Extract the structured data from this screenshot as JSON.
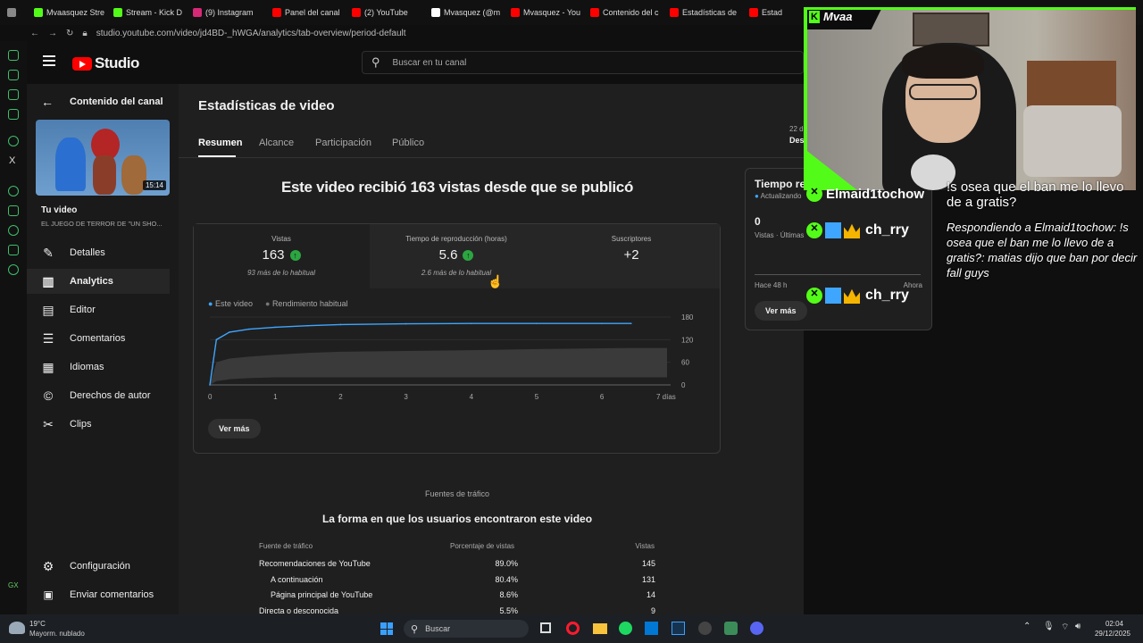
{
  "browser": {
    "tabs": [
      {
        "label": "",
        "color": "#888888"
      },
      {
        "label": "Mvaasquez Stre",
        "color": "#53fc18"
      },
      {
        "label": "Stream - Kick D",
        "color": "#53fc18"
      },
      {
        "label": "(9) Instagram",
        "color": "#d62976"
      },
      {
        "label": "Panel del canal",
        "color": "#ff0000"
      },
      {
        "label": "(2) YouTube",
        "color": "#ff0000"
      },
      {
        "label": "Mvasquez (@m",
        "color": "#ffffff"
      },
      {
        "label": "Mvasquez - You",
        "color": "#ff0000"
      },
      {
        "label": "Contenido del c",
        "color": "#ff0000"
      },
      {
        "label": "Estadísticas de",
        "color": "#ff0000"
      },
      {
        "label": "Estad",
        "color": "#ff0000"
      }
    ],
    "url": "studio.youtube.com/video/jd4BD-_hWGA/analytics/tab-overview/period-default"
  },
  "header": {
    "logo_text": "Studio",
    "search_placeholder": "Buscar en tu canal"
  },
  "sidebar": {
    "back_label": "Contenido del canal",
    "thumb_duration": "15:14",
    "your_video": "Tu video",
    "video_title": "EL JUEGO DE TERROR DE \"UN SHO...",
    "items": [
      {
        "label": "Detalles",
        "icon": "pencil-icon"
      },
      {
        "label": "Analytics",
        "icon": "analytics-icon"
      },
      {
        "label": "Editor",
        "icon": "editor-icon"
      },
      {
        "label": "Comentarios",
        "icon": "comments-icon"
      },
      {
        "label": "Idiomas",
        "icon": "subtitles-icon"
      },
      {
        "label": "Derechos de autor",
        "icon": "copyright-icon"
      },
      {
        "label": "Clips",
        "icon": "scissors-icon"
      }
    ],
    "settings_label": "Configuración",
    "feedback_label": "Enviar comentarios"
  },
  "page": {
    "title": "Estadísticas de video",
    "tabs": [
      "Resumen",
      "Alcance",
      "Participación",
      "Público"
    ],
    "date_partial": "22 d",
    "date_partial2": "Des",
    "headline": "Este video recibió 163 vistas desde que se publicó",
    "metrics": [
      {
        "label": "Vistas",
        "value": "163",
        "note": "93 más de lo habitual",
        "up": true
      },
      {
        "label": "Tiempo de reproducción (horas)",
        "value": "5.6",
        "note": "2.6 más de lo habitual",
        "up": true
      },
      {
        "label": "Suscriptores",
        "value": "+2",
        "note": "",
        "up": false
      }
    ],
    "legend": [
      "Este video",
      "Rendimiento habitual"
    ],
    "see_more": "Ver más",
    "realtime": {
      "title": "Tiempo re",
      "updating": "Actualizando",
      "count": "0",
      "sub": "Vistas · Últimas",
      "left": "Hace 48 h",
      "right": "Ahora",
      "button": "Ver más"
    },
    "traffic": {
      "kicker": "Fuentes de tráfico",
      "title": "La forma en que los usuarios encontraron este video",
      "headers": [
        "Fuente de tráfico",
        "Porcentaje de vistas",
        "Vistas"
      ],
      "rows": [
        {
          "source": "Recomendaciones de YouTube",
          "pct": "89.0%",
          "views": "145",
          "indent": false
        },
        {
          "source": "A continuación",
          "pct": "80.4%",
          "views": "131",
          "indent": true
        },
        {
          "source": "Página principal de YouTube",
          "pct": "8.6%",
          "views": "14",
          "indent": true
        },
        {
          "source": "Directa o desconocida",
          "pct": "5.5%",
          "views": "9",
          "indent": false
        }
      ]
    }
  },
  "chart_data": {
    "type": "line",
    "x": [
      0,
      0.1,
      0.3,
      0.6,
      1,
      1.5,
      2,
      3,
      4,
      5,
      6,
      6.45
    ],
    "xticks": [
      "0",
      "1",
      "2",
      "3",
      "4",
      "5",
      "6",
      "7 días"
    ],
    "yticks": [
      "180",
      "120",
      "60",
      "0"
    ],
    "ylim": [
      0,
      180
    ],
    "xlim": [
      0,
      7
    ],
    "series": [
      {
        "name": "Este video",
        "color": "#3ea6ff",
        "values": [
          0,
          120,
          140,
          148,
          153,
          157,
          160,
          162,
          163,
          163,
          163,
          163
        ]
      }
    ],
    "typical_band": {
      "name": "Rendimiento habitual",
      "upper": [
        0,
        60,
        70,
        75,
        80,
        85,
        88,
        90,
        92,
        95,
        97,
        98
      ],
      "lower": [
        0,
        10,
        15,
        18,
        20,
        20,
        20,
        20,
        20,
        20,
        20,
        20
      ]
    }
  },
  "stream": {
    "streamer": "Mvaa",
    "chat": [
      {
        "user": "Elmaid1tochow",
        "text": "!s osea que el ban me lo llevo de a gratis?"
      },
      {
        "user": "",
        "text": "Respondiendo a Elmaid1tochow: !s osea que el ban me lo llevo de a gratis?: matias dijo que ban por decir fall guys"
      },
      {
        "user": "ch_rry",
        "text": ""
      },
      {
        "user": "ch_rry",
        "text": ""
      }
    ]
  },
  "taskbar": {
    "weather_temp": "19°C",
    "weather_desc": "Mayorm. nublado",
    "search": "Buscar",
    "time": "02:04",
    "date": "29/12/2025"
  }
}
